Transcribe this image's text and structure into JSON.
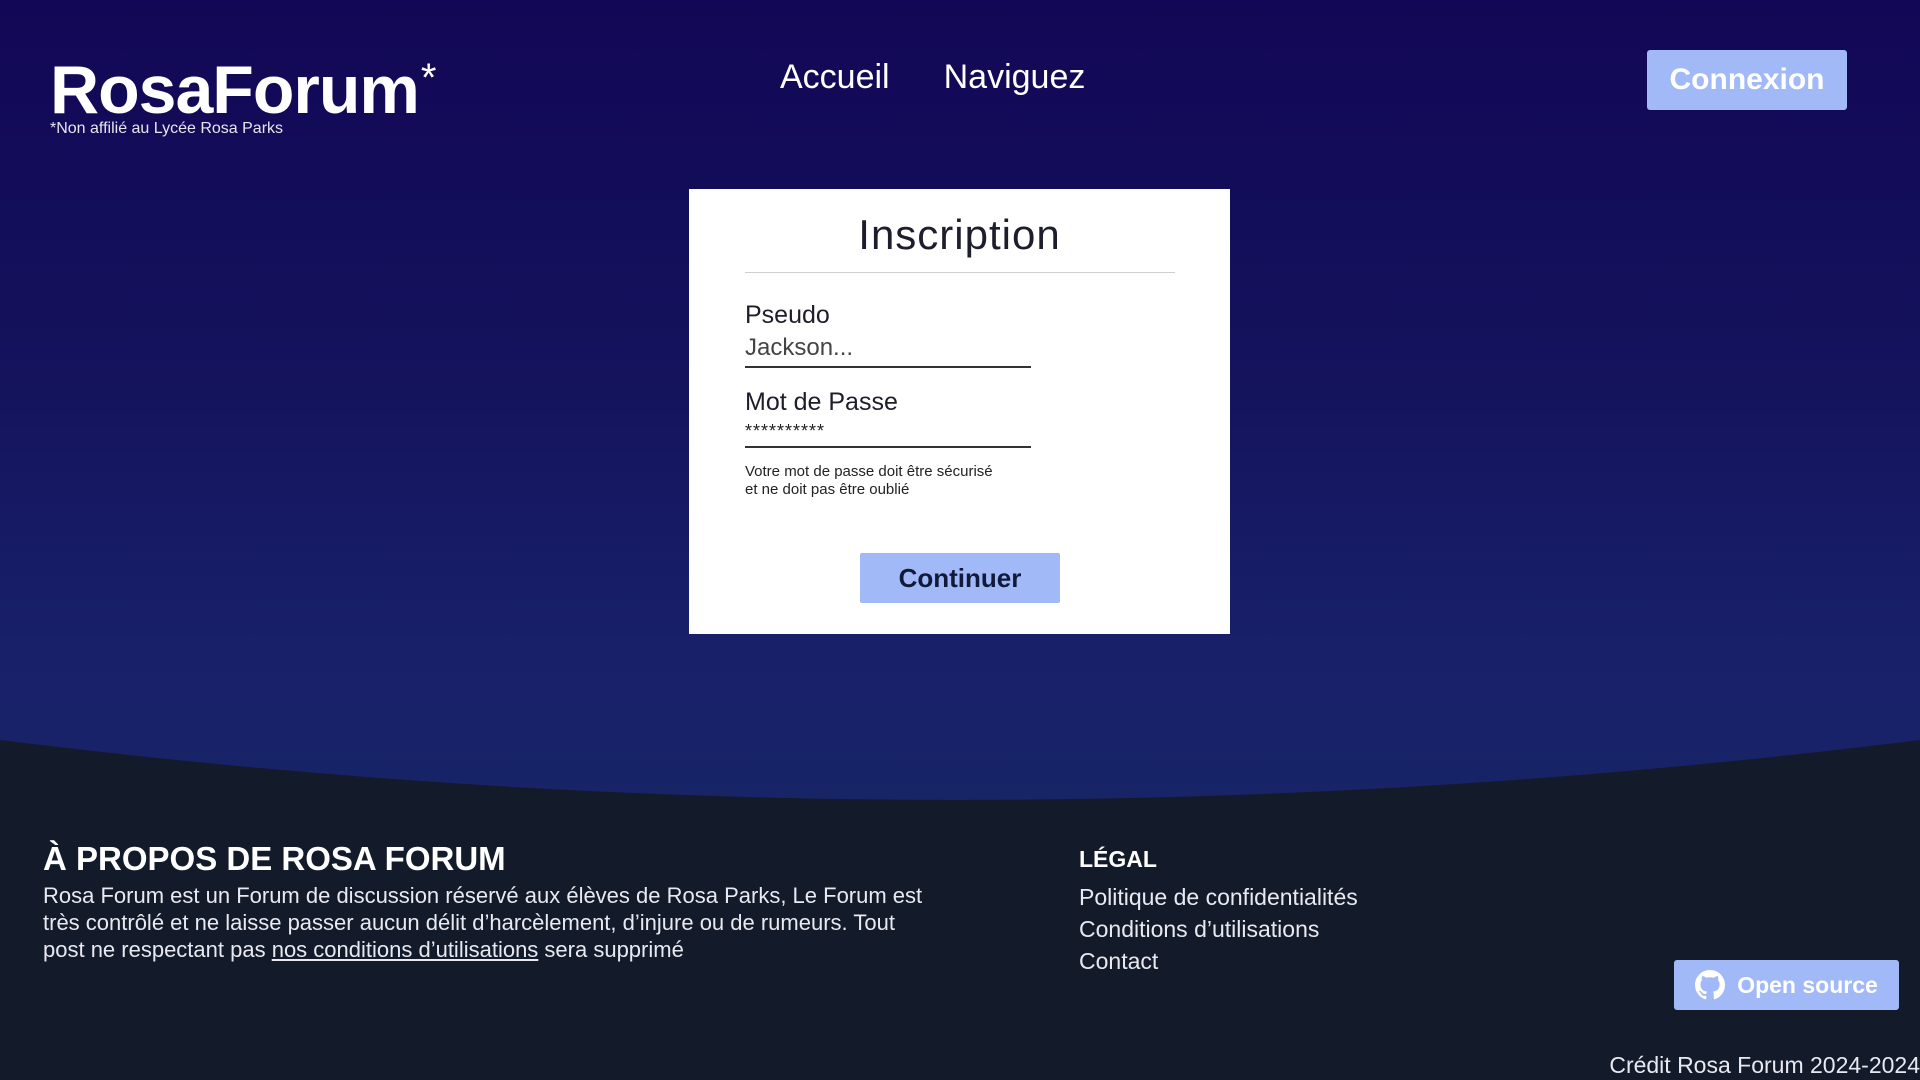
{
  "header": {
    "logo": "RosaForum",
    "logo_star": "*",
    "logo_subtitle": "*Non affilié au Lycée Rosa Parks",
    "nav": [
      "Accueil",
      "Naviguez"
    ],
    "login_button": "Connexion"
  },
  "form": {
    "title": "Inscription",
    "pseudo_label": "Pseudo",
    "pseudo_value": "Jackson...",
    "password_label": "Mot de Passe",
    "password_value": "**********",
    "hint_line1": "Votre mot de passe doit être sécurisé",
    "hint_line2": "et ne doit pas être oublié",
    "continue_button": "Continuer"
  },
  "footer": {
    "about_title": "À PROPOS DE ROSA FORUM",
    "about_text_before": "Rosa Forum est un Forum de discussion réservé aux élèves de Rosa Parks, Le Forum est très contrôlé et ne laisse passer aucun délit d’harcèlement, d’injure ou de rumeurs. Tout post ne respectant pas ",
    "about_link": "nos conditions d’utilisations",
    "about_text_after": " sera supprimé",
    "legal_title": "LÉGAL",
    "legal_links": [
      "Politique de confidentialités",
      "Conditions d’utilisations",
      "Contact"
    ],
    "open_source_button": "Open source",
    "credit": "Crédit Rosa Forum 2024-2024"
  },
  "colors": {
    "accent": "#a2b9f8",
    "header_bg": "#120756",
    "footer_bg": "#131a2a"
  },
  "icons": {
    "open_source": "github-icon"
  }
}
